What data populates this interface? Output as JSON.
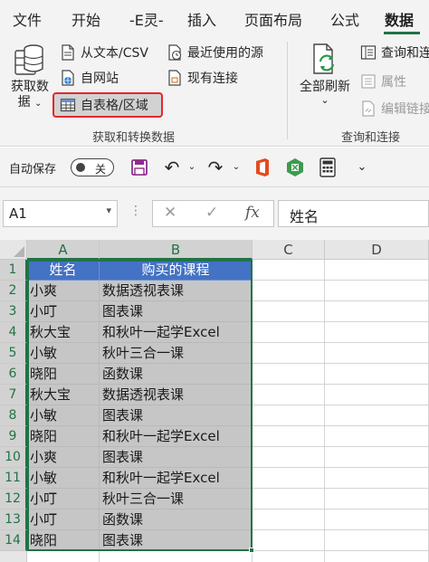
{
  "tabs": [
    {
      "label": "文件"
    },
    {
      "label": "开始"
    },
    {
      "label": "-E灵-"
    },
    {
      "label": "插入"
    },
    {
      "label": "页面布局"
    },
    {
      "label": "公式"
    },
    {
      "label": "数据"
    }
  ],
  "ribbon": {
    "get_data_label": "获取数",
    "get_data_label2": "据",
    "from_text_csv": "从文本/CSV",
    "recent_sources": "最近使用的源",
    "from_web": "自网站",
    "existing_connections": "现有连接",
    "from_table_range": "自表格/区域",
    "group_get_transform": "获取和转换数据",
    "refresh_all": "全部刷新",
    "queries_connections": "查询和连",
    "properties": "属性",
    "edit_links": "编辑链接",
    "group_queries": "查询和连接"
  },
  "qat": {
    "autosave_label": "自动保存",
    "autosave_state": "关"
  },
  "formula_bar": {
    "name_box": "A1",
    "cancel_symbol": "✕",
    "enter_symbol": "✓",
    "fx_symbol": "fx",
    "value": "姓名"
  },
  "grid": {
    "columns": [
      "A",
      "B",
      "C",
      "D"
    ],
    "row_numbers": [
      "1",
      "2",
      "3",
      "4",
      "5",
      "6",
      "7",
      "8",
      "9",
      "10",
      "11",
      "12",
      "13",
      "14"
    ],
    "header": [
      "姓名",
      "购买的课程"
    ],
    "rows": [
      [
        "小爽",
        "数据透视表课"
      ],
      [
        "小叮",
        "图表课"
      ],
      [
        "秋大宝",
        "和秋叶一起学Excel"
      ],
      [
        "小敏",
        "秋叶三合一课"
      ],
      [
        "晓阳",
        "函数课"
      ],
      [
        "秋大宝",
        "数据透视表课"
      ],
      [
        "小敏",
        "图表课"
      ],
      [
        "晓阳",
        "和秋叶一起学Excel"
      ],
      [
        "小爽",
        "图表课"
      ],
      [
        "小敏",
        "和秋叶一起学Excel"
      ],
      [
        "小叮",
        "秋叶三合一课"
      ],
      [
        "小叮",
        "函数课"
      ],
      [
        "晓阳",
        "图表课"
      ]
    ]
  }
}
